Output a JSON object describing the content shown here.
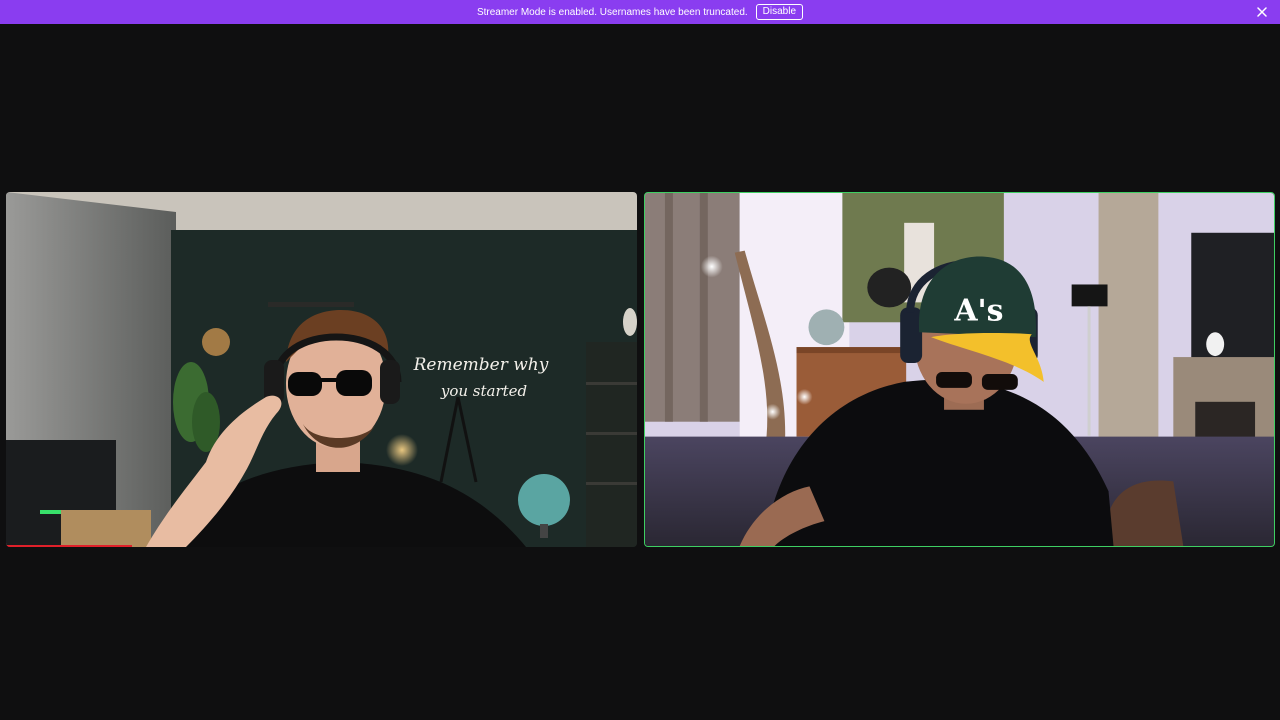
{
  "notice": {
    "text": "Streamer Mode is enabled. Usernames have been truncated.",
    "disable_label": "Disable",
    "close_icon": "close-icon",
    "bar_color": "#8a3df0"
  },
  "stage": {
    "participants": [
      {
        "id": "left",
        "speaking": false,
        "neon_sign_lines": [
          "Remember why",
          "you started"
        ]
      },
      {
        "id": "right",
        "speaking": true,
        "speaking_border_color": "#3ecf62",
        "cap_logo": "A's"
      }
    ]
  }
}
